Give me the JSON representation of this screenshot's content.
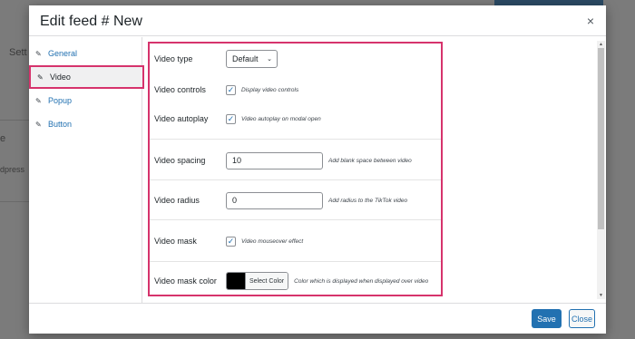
{
  "background": {
    "text_1": "Sett",
    "text_2": "e",
    "text_3": "dpress"
  },
  "modal": {
    "title": "Edit feed # New",
    "close_icon": "×"
  },
  "tabs": [
    {
      "label": "General",
      "icon": "pin-icon"
    },
    {
      "label": "Video",
      "icon": "pin-icon",
      "active": true
    },
    {
      "label": "Popup",
      "icon": "pin-icon"
    },
    {
      "label": "Button",
      "icon": "pin-icon"
    }
  ],
  "fields": {
    "video_type": {
      "label": "Video type",
      "value": "Default"
    },
    "video_controls": {
      "label": "Video controls",
      "checked": true,
      "hint": "Display video controls"
    },
    "video_autoplay": {
      "label": "Video autoplay",
      "checked": true,
      "hint": "Video autoplay on modal open"
    },
    "video_spacing": {
      "label": "Video spacing",
      "value": "10",
      "hint": "Add blank space between video"
    },
    "video_radius": {
      "label": "Video radius",
      "value": "0",
      "hint": "Add radius to the TikTok video"
    },
    "video_mask": {
      "label": "Video mask",
      "checked": true,
      "hint": "Video mouseover effect"
    },
    "video_mask_color": {
      "label": "Video mask color",
      "button": "Select Color",
      "swatch": "#000000",
      "hint": "Color which is displayed when displayed over video"
    }
  },
  "footer": {
    "save_label": "Save",
    "close_label": "Close"
  },
  "colors": {
    "accent": "#2271b1",
    "highlight": "#d6336c"
  }
}
